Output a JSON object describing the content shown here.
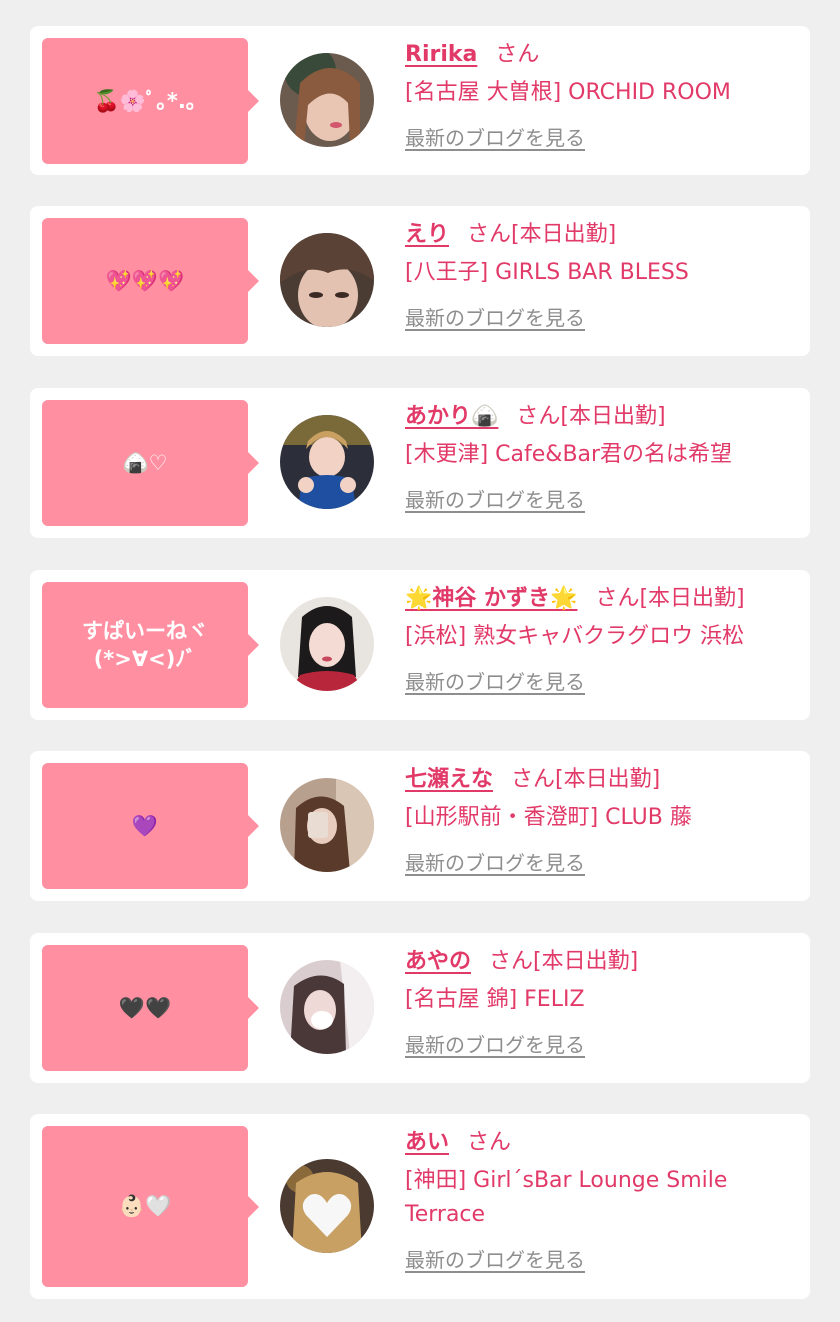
{
  "colors": {
    "page_background": "#efefef",
    "card_background": "#ffffff",
    "bubble_pink": "#ff8fa1",
    "accent_pink": "#e23a68",
    "link_gray": "#8e8e8e"
  },
  "cards": [
    {
      "bubble": "🍒🌸ﾟ｡*.｡",
      "name": "Ririka",
      "san": "さん",
      "status": "",
      "shop": "[名古屋 大曽根] ORCHID ROOM",
      "blog_link": "最新のブログを見る"
    },
    {
      "bubble": "💖💖💖",
      "name": "えり",
      "san": "さん",
      "status": "[本日出勤]",
      "shop": "[八王子] GIRLS BAR BLESS",
      "blog_link": "最新のブログを見る"
    },
    {
      "bubble": "🍙♡",
      "name": "あかり🍙",
      "san": "さん",
      "status": "[本日出勤]",
      "shop": "[木更津] Cafe&Bar君の名は希望",
      "blog_link": "最新のブログを見る"
    },
    {
      "bubble": "すぱいーねヾ\n(*>∀<)ﾉﾞ",
      "name": "🌟神谷 かずき🌟",
      "san": "さん",
      "status": "[本日出勤]",
      "shop": "[浜松] 熟女キャバクラグロウ 浜松",
      "blog_link": "最新のブログを見る"
    },
    {
      "bubble": "💜",
      "name": "七瀬えな",
      "san": "さん",
      "status": "[本日出勤]",
      "shop": "[山形駅前・香澄町] CLUB 藤",
      "blog_link": "最新のブログを見る"
    },
    {
      "bubble": "🖤🖤",
      "name": "あやの",
      "san": "さん",
      "status": "[本日出勤]",
      "shop": "[名古屋 錦] FELIZ",
      "blog_link": "最新のブログを見る"
    },
    {
      "bubble": "👶🏻🤍",
      "name": "あい",
      "san": "さん",
      "status": "",
      "shop": "[神田] Girl´sBar Lounge Smile Terrace",
      "blog_link": "最新のブログを見る"
    }
  ]
}
